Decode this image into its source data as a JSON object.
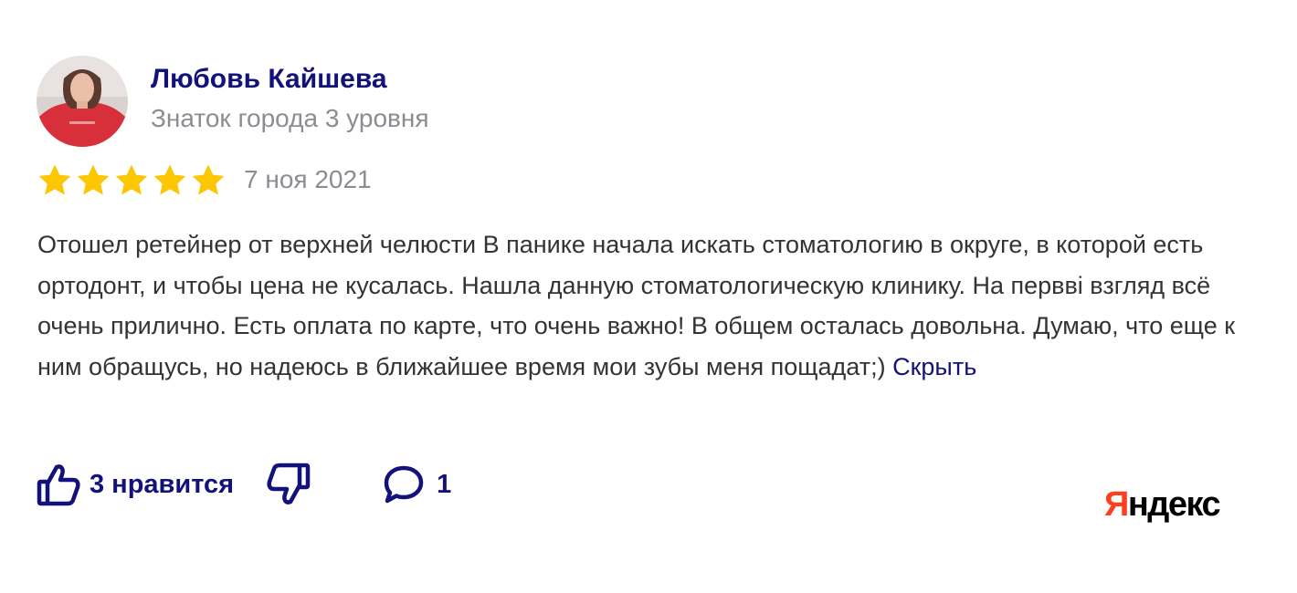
{
  "author": {
    "name": "Любовь Кайшева",
    "level": "Знаток города 3 уровня"
  },
  "rating": {
    "value": 5,
    "max": 5,
    "star_color": "#fcc600"
  },
  "date": "7 ноя 2021",
  "review": {
    "text": "Отошел ретейнер от верхней челюсти В панике начала искать стоматологию в округе, в которой есть ортодонт, и чтобы цена не кусалась. Нашла данную стоматологическую клинику. На первві взгляд всё очень прилично. Есть оплата по карте, что очень важно! В общем осталась довольна. Думаю, что еще к ним обращусь, но надеюсь в ближайшее время мои зубы меня пощадат;)",
    "hide_link": "Скрыть"
  },
  "actions": {
    "like_label": "3 нравится",
    "comments_count": "1"
  },
  "brand": {
    "first_letter": "Я",
    "rest": "ндекс",
    "accent": "#fc3f1d"
  },
  "colors": {
    "link": "#12127a",
    "muted": "#8c8c93",
    "text": "#333333"
  },
  "icons": {
    "like": "thumbs-up-icon",
    "dislike": "thumbs-down-icon",
    "comment": "comment-icon"
  }
}
